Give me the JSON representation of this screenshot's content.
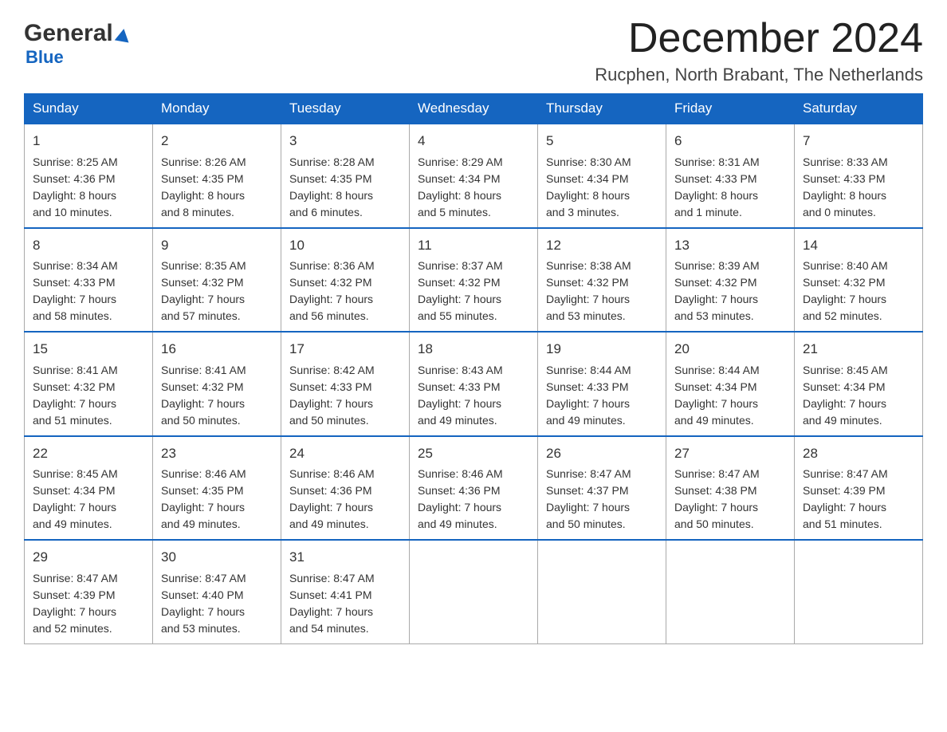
{
  "header": {
    "logo_general": "General",
    "logo_blue": "Blue",
    "month_title": "December 2024",
    "location": "Rucphen, North Brabant, The Netherlands"
  },
  "days_of_week": [
    "Sunday",
    "Monday",
    "Tuesday",
    "Wednesday",
    "Thursday",
    "Friday",
    "Saturday"
  ],
  "weeks": [
    [
      {
        "day": "1",
        "sunrise": "Sunrise: 8:25 AM",
        "sunset": "Sunset: 4:36 PM",
        "daylight": "Daylight: 8 hours",
        "daylight2": "and 10 minutes."
      },
      {
        "day": "2",
        "sunrise": "Sunrise: 8:26 AM",
        "sunset": "Sunset: 4:35 PM",
        "daylight": "Daylight: 8 hours",
        "daylight2": "and 8 minutes."
      },
      {
        "day": "3",
        "sunrise": "Sunrise: 8:28 AM",
        "sunset": "Sunset: 4:35 PM",
        "daylight": "Daylight: 8 hours",
        "daylight2": "and 6 minutes."
      },
      {
        "day": "4",
        "sunrise": "Sunrise: 8:29 AM",
        "sunset": "Sunset: 4:34 PM",
        "daylight": "Daylight: 8 hours",
        "daylight2": "and 5 minutes."
      },
      {
        "day": "5",
        "sunrise": "Sunrise: 8:30 AM",
        "sunset": "Sunset: 4:34 PM",
        "daylight": "Daylight: 8 hours",
        "daylight2": "and 3 minutes."
      },
      {
        "day": "6",
        "sunrise": "Sunrise: 8:31 AM",
        "sunset": "Sunset: 4:33 PM",
        "daylight": "Daylight: 8 hours",
        "daylight2": "and 1 minute."
      },
      {
        "day": "7",
        "sunrise": "Sunrise: 8:33 AM",
        "sunset": "Sunset: 4:33 PM",
        "daylight": "Daylight: 8 hours",
        "daylight2": "and 0 minutes."
      }
    ],
    [
      {
        "day": "8",
        "sunrise": "Sunrise: 8:34 AM",
        "sunset": "Sunset: 4:33 PM",
        "daylight": "Daylight: 7 hours",
        "daylight2": "and 58 minutes."
      },
      {
        "day": "9",
        "sunrise": "Sunrise: 8:35 AM",
        "sunset": "Sunset: 4:32 PM",
        "daylight": "Daylight: 7 hours",
        "daylight2": "and 57 minutes."
      },
      {
        "day": "10",
        "sunrise": "Sunrise: 8:36 AM",
        "sunset": "Sunset: 4:32 PM",
        "daylight": "Daylight: 7 hours",
        "daylight2": "and 56 minutes."
      },
      {
        "day": "11",
        "sunrise": "Sunrise: 8:37 AM",
        "sunset": "Sunset: 4:32 PM",
        "daylight": "Daylight: 7 hours",
        "daylight2": "and 55 minutes."
      },
      {
        "day": "12",
        "sunrise": "Sunrise: 8:38 AM",
        "sunset": "Sunset: 4:32 PM",
        "daylight": "Daylight: 7 hours",
        "daylight2": "and 53 minutes."
      },
      {
        "day": "13",
        "sunrise": "Sunrise: 8:39 AM",
        "sunset": "Sunset: 4:32 PM",
        "daylight": "Daylight: 7 hours",
        "daylight2": "and 53 minutes."
      },
      {
        "day": "14",
        "sunrise": "Sunrise: 8:40 AM",
        "sunset": "Sunset: 4:32 PM",
        "daylight": "Daylight: 7 hours",
        "daylight2": "and 52 minutes."
      }
    ],
    [
      {
        "day": "15",
        "sunrise": "Sunrise: 8:41 AM",
        "sunset": "Sunset: 4:32 PM",
        "daylight": "Daylight: 7 hours",
        "daylight2": "and 51 minutes."
      },
      {
        "day": "16",
        "sunrise": "Sunrise: 8:41 AM",
        "sunset": "Sunset: 4:32 PM",
        "daylight": "Daylight: 7 hours",
        "daylight2": "and 50 minutes."
      },
      {
        "day": "17",
        "sunrise": "Sunrise: 8:42 AM",
        "sunset": "Sunset: 4:33 PM",
        "daylight": "Daylight: 7 hours",
        "daylight2": "and 50 minutes."
      },
      {
        "day": "18",
        "sunrise": "Sunrise: 8:43 AM",
        "sunset": "Sunset: 4:33 PM",
        "daylight": "Daylight: 7 hours",
        "daylight2": "and 49 minutes."
      },
      {
        "day": "19",
        "sunrise": "Sunrise: 8:44 AM",
        "sunset": "Sunset: 4:33 PM",
        "daylight": "Daylight: 7 hours",
        "daylight2": "and 49 minutes."
      },
      {
        "day": "20",
        "sunrise": "Sunrise: 8:44 AM",
        "sunset": "Sunset: 4:34 PM",
        "daylight": "Daylight: 7 hours",
        "daylight2": "and 49 minutes."
      },
      {
        "day": "21",
        "sunrise": "Sunrise: 8:45 AM",
        "sunset": "Sunset: 4:34 PM",
        "daylight": "Daylight: 7 hours",
        "daylight2": "and 49 minutes."
      }
    ],
    [
      {
        "day": "22",
        "sunrise": "Sunrise: 8:45 AM",
        "sunset": "Sunset: 4:34 PM",
        "daylight": "Daylight: 7 hours",
        "daylight2": "and 49 minutes."
      },
      {
        "day": "23",
        "sunrise": "Sunrise: 8:46 AM",
        "sunset": "Sunset: 4:35 PM",
        "daylight": "Daylight: 7 hours",
        "daylight2": "and 49 minutes."
      },
      {
        "day": "24",
        "sunrise": "Sunrise: 8:46 AM",
        "sunset": "Sunset: 4:36 PM",
        "daylight": "Daylight: 7 hours",
        "daylight2": "and 49 minutes."
      },
      {
        "day": "25",
        "sunrise": "Sunrise: 8:46 AM",
        "sunset": "Sunset: 4:36 PM",
        "daylight": "Daylight: 7 hours",
        "daylight2": "and 49 minutes."
      },
      {
        "day": "26",
        "sunrise": "Sunrise: 8:47 AM",
        "sunset": "Sunset: 4:37 PM",
        "daylight": "Daylight: 7 hours",
        "daylight2": "and 50 minutes."
      },
      {
        "day": "27",
        "sunrise": "Sunrise: 8:47 AM",
        "sunset": "Sunset: 4:38 PM",
        "daylight": "Daylight: 7 hours",
        "daylight2": "and 50 minutes."
      },
      {
        "day": "28",
        "sunrise": "Sunrise: 8:47 AM",
        "sunset": "Sunset: 4:39 PM",
        "daylight": "Daylight: 7 hours",
        "daylight2": "and 51 minutes."
      }
    ],
    [
      {
        "day": "29",
        "sunrise": "Sunrise: 8:47 AM",
        "sunset": "Sunset: 4:39 PM",
        "daylight": "Daylight: 7 hours",
        "daylight2": "and 52 minutes."
      },
      {
        "day": "30",
        "sunrise": "Sunrise: 8:47 AM",
        "sunset": "Sunset: 4:40 PM",
        "daylight": "Daylight: 7 hours",
        "daylight2": "and 53 minutes."
      },
      {
        "day": "31",
        "sunrise": "Sunrise: 8:47 AM",
        "sunset": "Sunset: 4:41 PM",
        "daylight": "Daylight: 7 hours",
        "daylight2": "and 54 minutes."
      },
      null,
      null,
      null,
      null
    ]
  ]
}
